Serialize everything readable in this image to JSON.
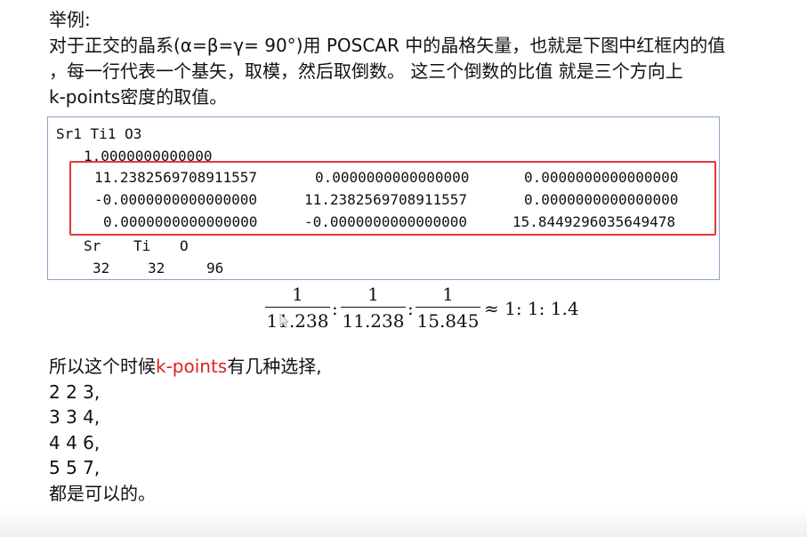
{
  "intro": {
    "line1": "举例:",
    "line2": "对于正交的晶系(α=β=γ= 90°)用 POSCAR 中的晶格矢量，也就是下图中红框内的值",
    "line3": "，每一行代表一个基矢，取模，然后取倒数。 这三个倒数的比值 就是三个方向上",
    "line4": "k-points密度的取值。"
  },
  "poscar": {
    "comment": "Sr1 Ti1 O3",
    "scale": "1.0000000000000",
    "lattice": [
      [
        "11.2382569708911557",
        "0.0000000000000000",
        "0.0000000000000000"
      ],
      [
        "-0.0000000000000000",
        "11.2382569708911557",
        "0.0000000000000000"
      ],
      [
        "0.0000000000000000",
        "-0.0000000000000000",
        "15.8449296035649478"
      ]
    ],
    "species": [
      "Sr",
      "Ti",
      "O"
    ],
    "counts": [
      "32",
      "32",
      "96"
    ]
  },
  "formula": {
    "numerators": [
      "1",
      "1",
      "1"
    ],
    "denominators": [
      "11.238",
      "11.238",
      "15.845"
    ],
    "separator": ":",
    "result": "≈ 1: 1: 1.4"
  },
  "summary": {
    "prefix": "所以这个时候",
    "highlight": "k-points",
    "suffix": "有几种选择,",
    "options": [
      "2 2 3,",
      "3 3 4,",
      "4 4 6,",
      "5 5 7,"
    ],
    "closing": "都是可以的。"
  },
  "colors": {
    "highlight": "#e02020",
    "frame": "#e03a3e",
    "panel_border": "#8aa4c8"
  }
}
